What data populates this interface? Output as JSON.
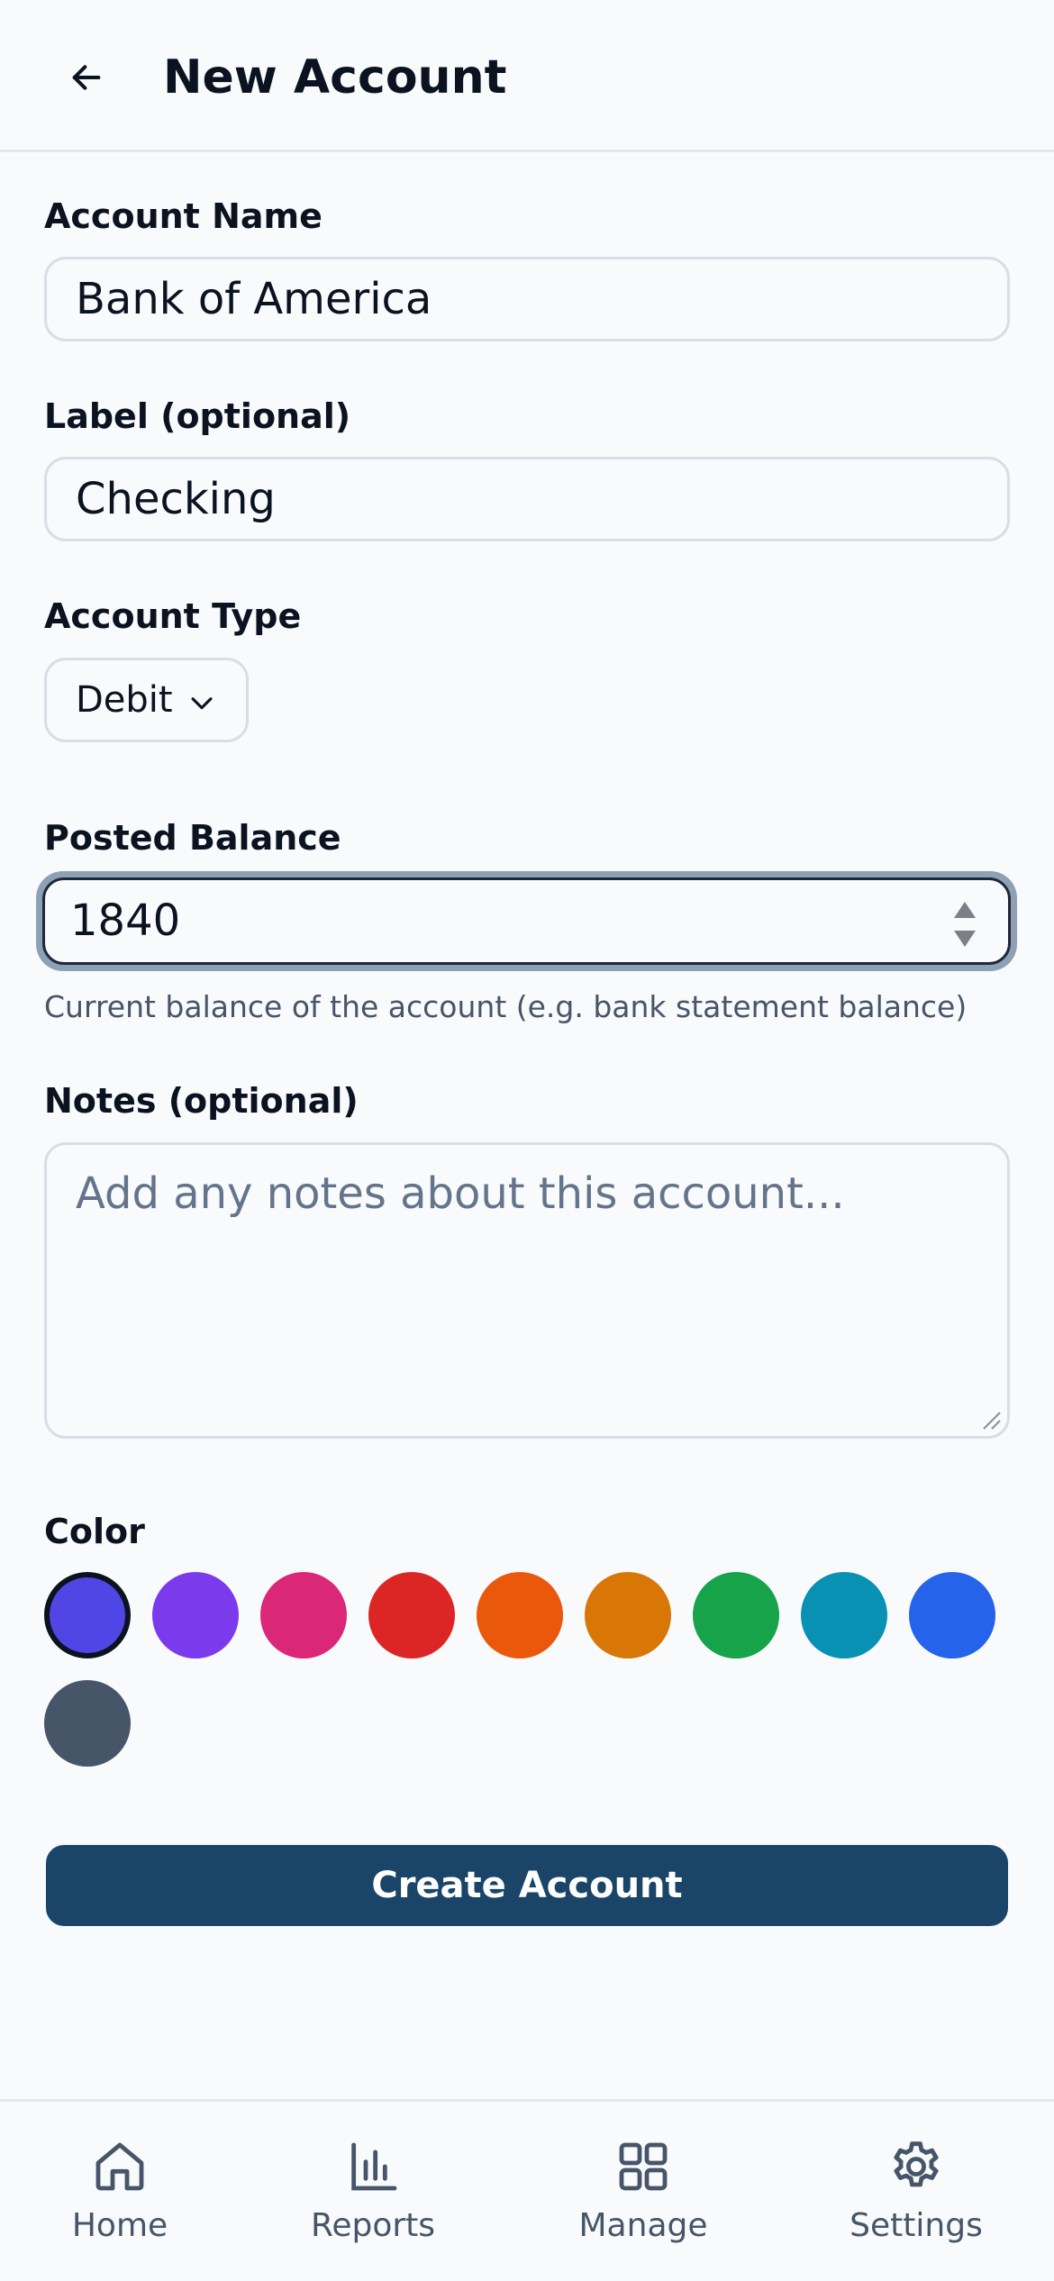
{
  "header": {
    "title": "New Account",
    "back_icon": "arrow-left-icon"
  },
  "form": {
    "account_name": {
      "label": "Account Name",
      "value": "Bank of America"
    },
    "label_field": {
      "label": "Label (optional)",
      "value": "Checking"
    },
    "account_type": {
      "label": "Account Type",
      "value": "Debit"
    },
    "posted_balance": {
      "label": "Posted Balance",
      "value": "1840",
      "helper": "Current balance of the account (e.g. bank statement balance)"
    },
    "notes": {
      "label": "Notes (optional)",
      "placeholder": "Add any notes about this account..."
    },
    "color": {
      "label": "Color",
      "selected": "#4f46e5",
      "options": [
        "#4f46e5",
        "#7c3aed",
        "#db2777",
        "#dc2626",
        "#ea580c",
        "#d97706",
        "#16a34a",
        "#0891b2",
        "#2563eb",
        "#475569"
      ]
    },
    "submit_label": "Create Account"
  },
  "nav": {
    "items": [
      {
        "label": "Home",
        "icon": "home-icon"
      },
      {
        "label": "Reports",
        "icon": "bar-chart-icon"
      },
      {
        "label": "Manage",
        "icon": "grid-icon"
      },
      {
        "label": "Settings",
        "icon": "gear-icon"
      }
    ]
  },
  "colors": {
    "primary_button": "#1b4568",
    "focus_ring": "#8ea1b4"
  }
}
